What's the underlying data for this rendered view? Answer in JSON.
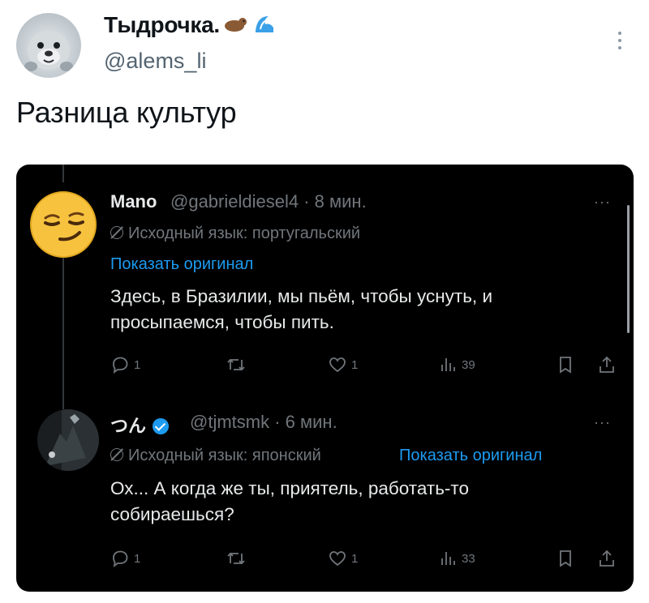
{
  "post": {
    "author_name": "Тыдрочка.",
    "author_emoji": "🦦🌊",
    "handle": "@alems_li",
    "text": "Разница культур"
  },
  "screenshot": {
    "tweets": [
      {
        "name": "Mano",
        "handle": "@gabrieldiesel4",
        "time": "8 мин.",
        "lang_note": "Исходный язык: португальский",
        "show_original": "Показать оригинал",
        "body_lines": [
          "Здесь, в Бразилии, мы пьём, чтобы уснуть, и",
          "просыпаемся, чтобы пить."
        ],
        "replies": "1",
        "likes": "1",
        "views": "39",
        "avatar_icon": "smirking-face-emoji"
      },
      {
        "name": "つん",
        "handle": "@tjmtsmk",
        "time": "6 мин.",
        "verified": true,
        "lang_note": "Исходный язык: японский",
        "show_original": "Показать оригинал",
        "body_lines": [
          "Ох... А когда же ты, приятель, работать-то",
          "собираешься?"
        ],
        "replies": "1",
        "likes": "1",
        "views": "33",
        "avatar_icon": "dark-photo-avatar"
      }
    ],
    "more_label": "···"
  },
  "colors": {
    "accent": "#1d9bf0",
    "dark_bg": "#000000",
    "muted": "#71767b"
  }
}
